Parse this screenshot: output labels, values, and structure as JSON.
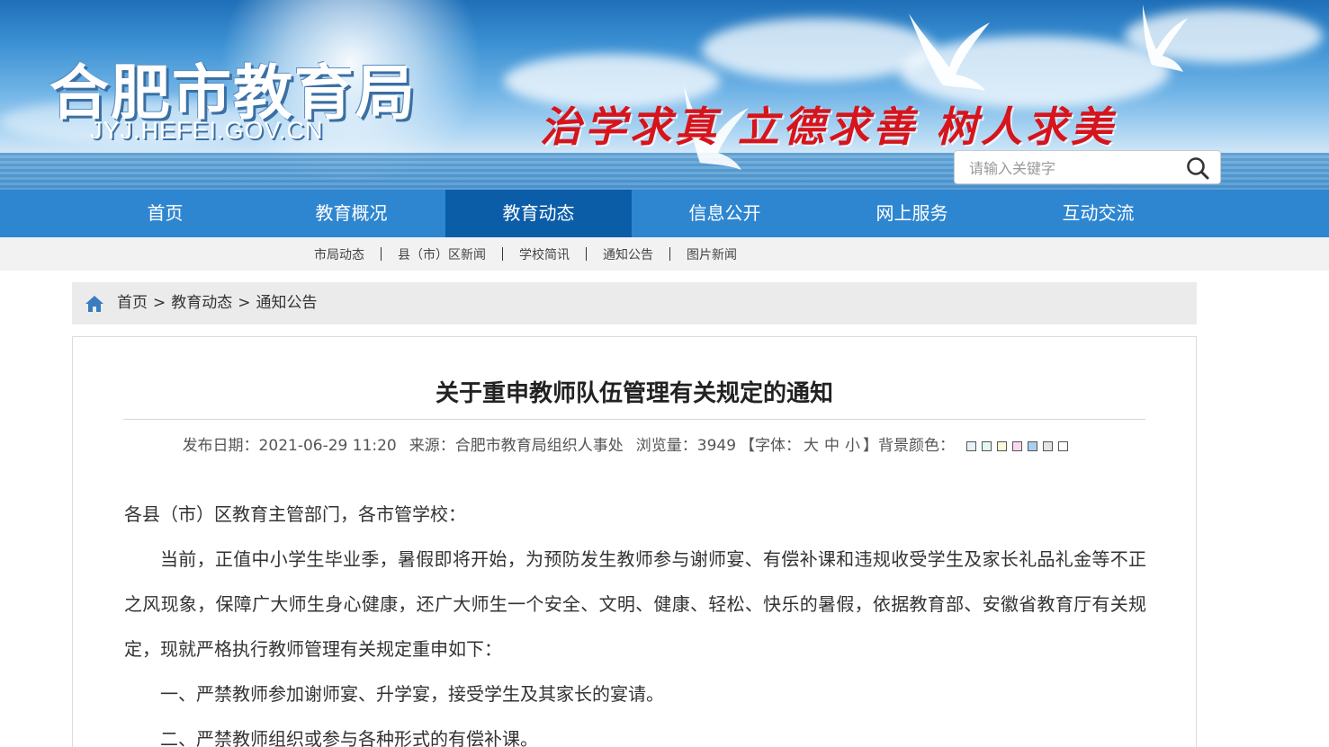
{
  "header": {
    "site_name": "合肥市教育局",
    "site_domain": "JYJ.HEFEI.GOV.CN",
    "motto": "治学求真 立德求善 树人求美",
    "search_placeholder": "请输入关键字"
  },
  "nav": {
    "items": [
      {
        "label": "首页"
      },
      {
        "label": "教育概况"
      },
      {
        "label": "教育动态",
        "active": true
      },
      {
        "label": "信息公开"
      },
      {
        "label": "网上服务"
      },
      {
        "label": "互动交流"
      }
    ]
  },
  "subnav": {
    "items": [
      {
        "label": "市局动态"
      },
      {
        "label": "县（市）区新闻"
      },
      {
        "label": "学校简讯"
      },
      {
        "label": "通知公告"
      },
      {
        "label": "图片新闻"
      }
    ]
  },
  "breadcrumb": {
    "items": [
      {
        "label": "首页"
      },
      {
        "label": "教育动态"
      },
      {
        "label": "通知公告"
      }
    ],
    "separator": ">"
  },
  "article": {
    "title": "关于重申教师队伍管理有关规定的通知",
    "meta": {
      "date_label": "发布日期：2021-06-29 11:20",
      "source_label": "来源：合肥市教育局组织人事处",
      "views_label": "浏览量：3949",
      "font_open": "【字体：",
      "font_large": "大",
      "font_medium": "中",
      "font_small": "小",
      "font_close": "】",
      "bg_label": "背景颜色："
    },
    "bg_swatches": [
      "#e6f2fb",
      "#e3f7f5",
      "#fbfbd8",
      "#fbd8f0",
      "#a9cff0",
      "#e4e4e4",
      "#ffffff"
    ],
    "paragraphs": [
      "各县（市）区教育主管部门，各市管学校：",
      "当前，正值中小学生毕业季，暑假即将开始，为预防发生教师参与谢师宴、有偿补课和违规收受学生及家长礼品礼金等不正之风现象，保障广大师生身心健康，还广大师生一个安全、文明、健康、轻松、快乐的暑假，依据教育部、安徽省教育厅有关规定，现就严格执行教师管理有关规定重申如下：",
      "一、严禁教师参加谢师宴、升学宴，接受学生及其家长的宴请。",
      "二、严禁教师组织或参与各种形式的有偿补课。"
    ]
  },
  "colors": {
    "nav_bg": "#2e86d1",
    "nav_active_bg": "#0b5da8",
    "motto_color": "#d6141c",
    "subnav_bg": "#f2f2f2",
    "breadcrumb_bg": "#ebebeb"
  },
  "icons": {
    "search": "search-icon",
    "home": "home-icon"
  }
}
